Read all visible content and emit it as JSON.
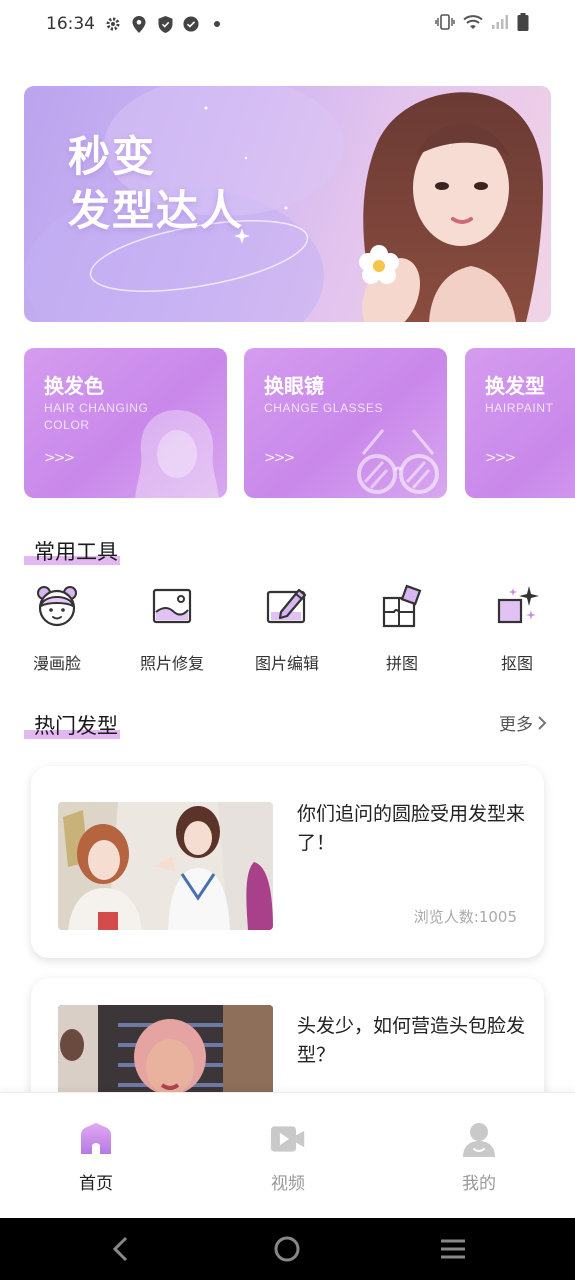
{
  "status_bar": {
    "time": "16:34",
    "left_icons": [
      "gear-icon",
      "location-icon",
      "shield-icon",
      "check-circle-icon",
      "dot-icon"
    ],
    "right_icons": [
      "vibrate-icon",
      "wifi-icon",
      "signal-icon",
      "battery-icon"
    ]
  },
  "banner": {
    "title_line1": "秒变",
    "title_line2": "发型达人"
  },
  "features": [
    {
      "title": "换发色",
      "subtitle": "HAIR CHANGING COLOR",
      "arrows": ">>>",
      "icon": "hair-silhouette-icon"
    },
    {
      "title": "换眼镜",
      "subtitle": "CHANGE GLASSES",
      "arrows": ">>>",
      "icon": "glasses-icon"
    },
    {
      "title": "换发型",
      "subtitle": "HAIRPAINT",
      "arrows": ">>>",
      "icon": "hairstyle-icon"
    }
  ],
  "tools_section": {
    "title": "常用工具",
    "items": [
      {
        "label": "漫画脸",
        "icon": "cartoon-face-icon"
      },
      {
        "label": "照片修复",
        "icon": "photo-repair-icon"
      },
      {
        "label": "图片编辑",
        "icon": "image-edit-icon"
      },
      {
        "label": "拼图",
        "icon": "puzzle-icon"
      },
      {
        "label": "抠图",
        "icon": "cutout-icon"
      }
    ]
  },
  "hot_section": {
    "title": "热门发型",
    "more": "更多"
  },
  "articles": [
    {
      "title": "你们追问的圆脸受用发型来了！",
      "views": "浏览人数:1005"
    },
    {
      "title": "头发少，如何营造头包脸发型？",
      "views": ""
    }
  ],
  "bottom_nav": [
    {
      "label": "首页",
      "icon": "home-icon",
      "active": true
    },
    {
      "label": "视频",
      "icon": "video-icon",
      "active": false
    },
    {
      "label": "我的",
      "icon": "profile-icon",
      "active": false
    }
  ],
  "colors": {
    "accent": "#c98aea",
    "highlight": "#e3b8f2",
    "text": "#222222",
    "muted": "#999999"
  }
}
